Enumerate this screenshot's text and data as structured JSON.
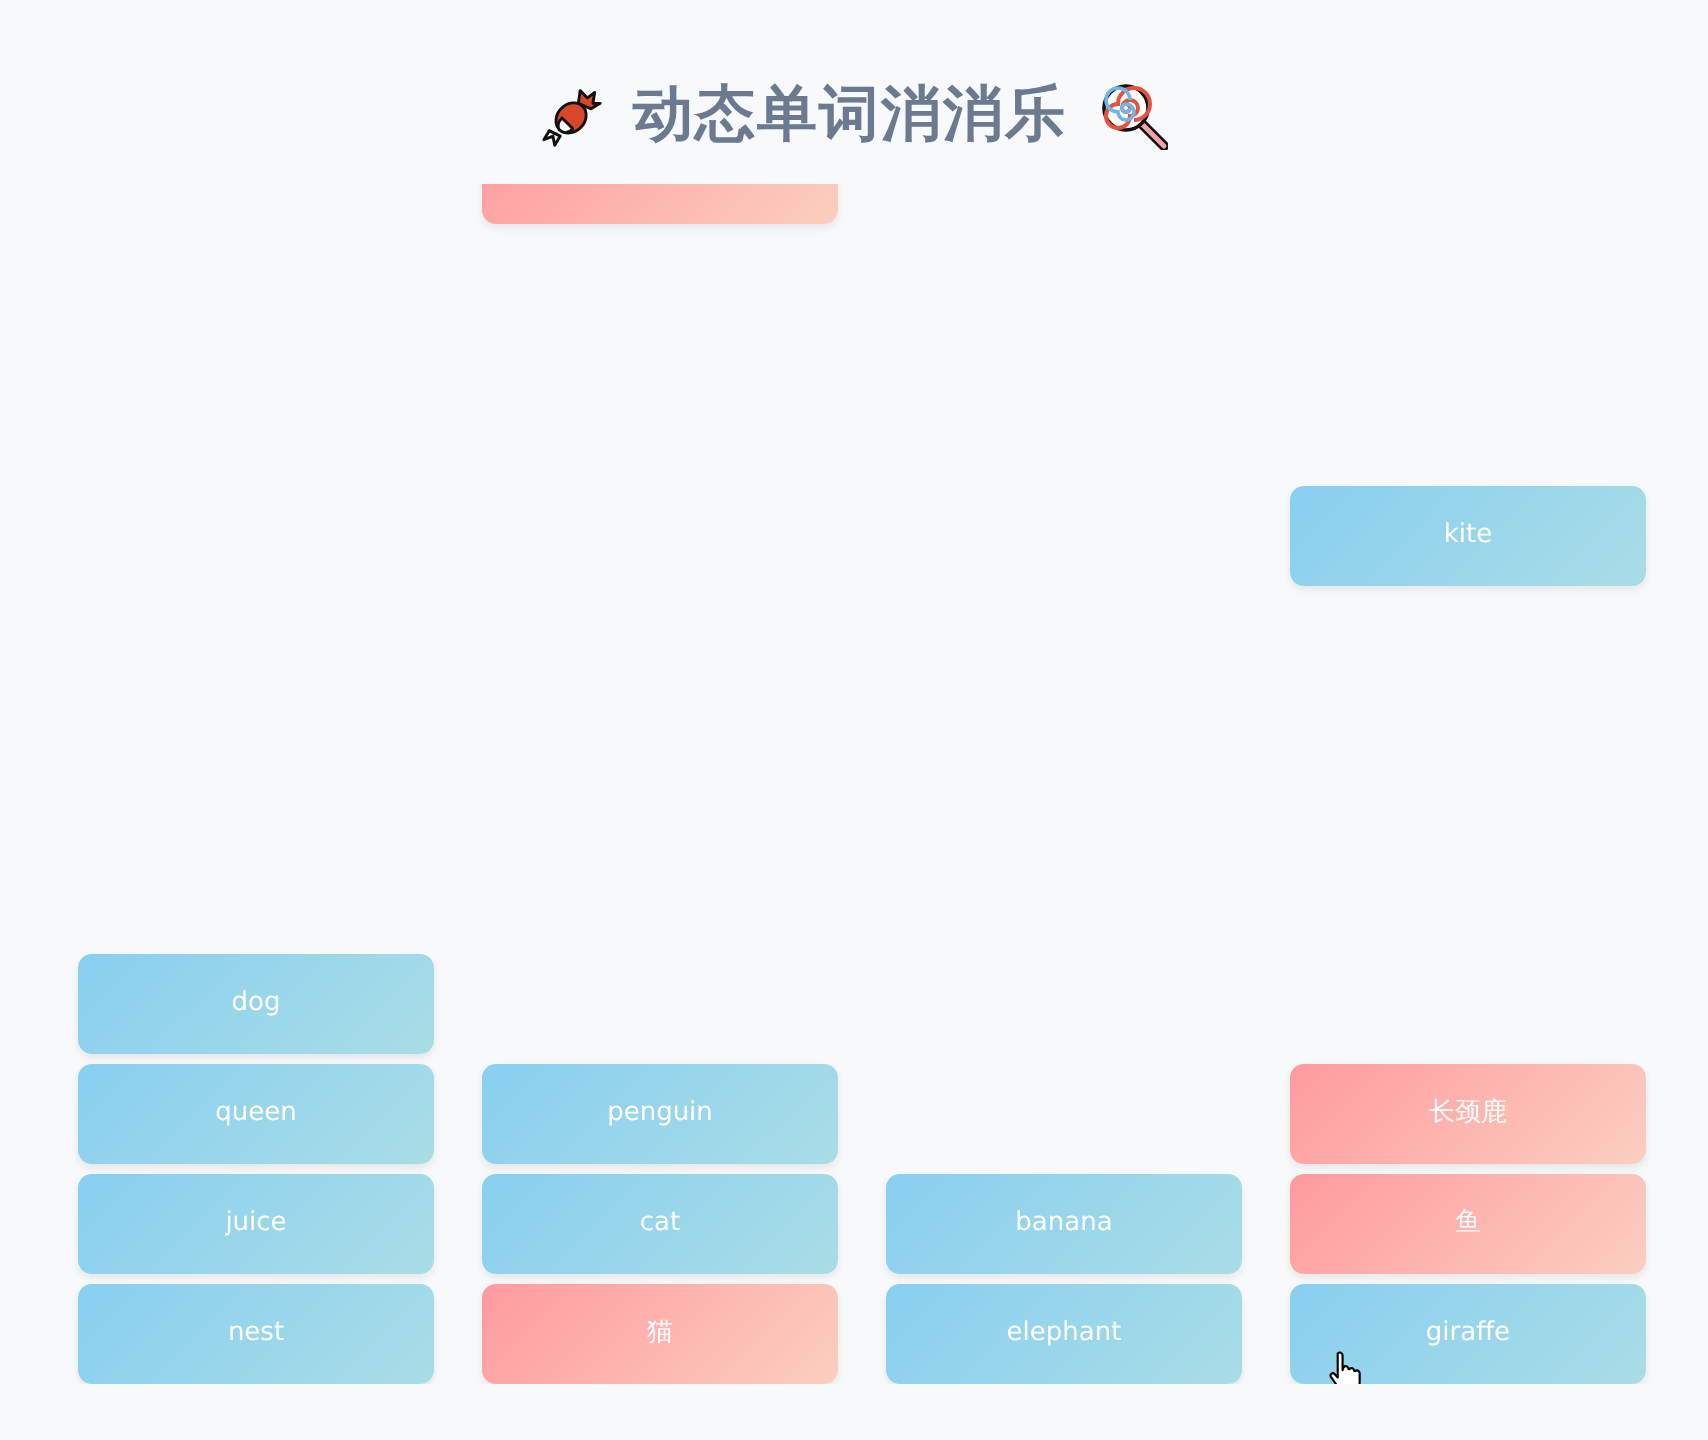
{
  "title": "动态单词消消乐",
  "columns": [
    {
      "stack": [
        {
          "word": "dog",
          "kind": "english"
        },
        {
          "word": "queen",
          "kind": "english"
        },
        {
          "word": "juice",
          "kind": "english"
        },
        {
          "word": "nest",
          "kind": "english"
        }
      ]
    },
    {
      "falling": {
        "kind": "chinese"
      },
      "stack": [
        {
          "word": "penguin",
          "kind": "english"
        },
        {
          "word": "cat",
          "kind": "english"
        },
        {
          "word": "猫",
          "kind": "chinese"
        }
      ]
    },
    {
      "stack": [
        {
          "word": "banana",
          "kind": "english"
        },
        {
          "word": "elephant",
          "kind": "english"
        }
      ]
    },
    {
      "falling": {
        "word": "kite",
        "kind": "english"
      },
      "stack": [
        {
          "word": "长颈鹿",
          "kind": "chinese"
        },
        {
          "word": "鱼",
          "kind": "chinese"
        },
        {
          "word": "giraffe",
          "kind": "english"
        }
      ]
    }
  ]
}
